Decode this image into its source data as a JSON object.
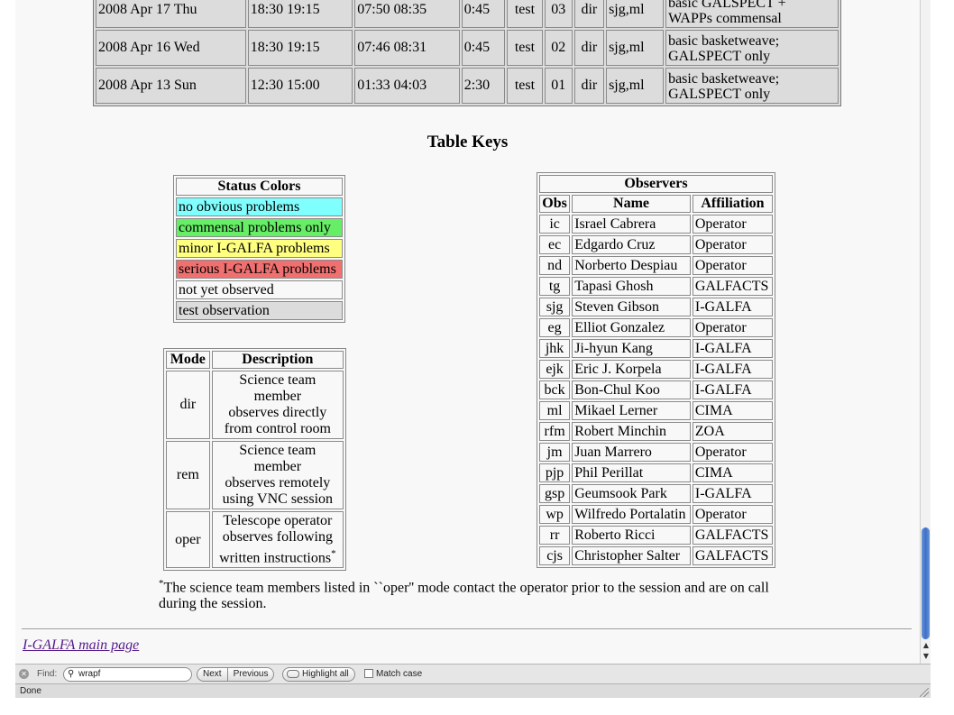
{
  "schedule": {
    "rows": [
      {
        "date": "2008 Apr 17 Thu",
        "lst": "18:30 19:15",
        "ast": "07:50 08:35",
        "dur": "0:45",
        "project": "test",
        "session": "03",
        "mode": "dir",
        "observers": "sjg,ml",
        "notes": "basic GALSPECT + WAPPs commensal",
        "notes_l1": "basic GALSPECT +",
        "notes_l2": "WAPPs commensal"
      },
      {
        "date": "2008 Apr 16 Wed",
        "lst": "18:30 19:15",
        "ast": "07:46 08:31",
        "dur": "0:45",
        "project": "test",
        "session": "02",
        "mode": "dir",
        "observers": "sjg,ml",
        "notes_l1": "basic basketweave;",
        "notes_l2": "GALSPECT only"
      },
      {
        "date": "2008 Apr 13 Sun",
        "lst": "12:30 15:00",
        "ast": "01:33 04:03",
        "dur": "2:30",
        "project": "test",
        "session": "01",
        "mode": "dir",
        "observers": "sjg,ml",
        "notes_l1": "basic basketweave;",
        "notes_l2": "GALSPECT only"
      }
    ]
  },
  "keys_title": "Table Keys",
  "status_colors": {
    "header": "Status Colors",
    "items": [
      {
        "label": "no obvious problems",
        "color": "#80ffff"
      },
      {
        "label": "commensal problems only",
        "color": "#66ee66"
      },
      {
        "label": "minor I-GALFA problems",
        "color": "#ffff80"
      },
      {
        "label": "serious I-GALFA problems",
        "color": "#f07070"
      },
      {
        "label": "not yet observed",
        "color": "#f8f8f8"
      },
      {
        "label": "test observation",
        "color": "#dcdcdc"
      }
    ]
  },
  "modes": {
    "header_mode": "Mode",
    "header_desc": "Description",
    "rows": [
      {
        "mode": "dir",
        "d1": "Science team",
        "d2": "member",
        "d3": "observes directly",
        "d4": "from control room"
      },
      {
        "mode": "rem",
        "d1": "Science team",
        "d2": "member",
        "d3": "observes remotely",
        "d4": "using VNC session"
      },
      {
        "mode": "oper",
        "d1": "Telescope operator",
        "d2": "observes following",
        "d3": "written instructions",
        "d4": "*"
      }
    ]
  },
  "observers": {
    "title": "Observers",
    "col_obs": "Obs",
    "col_name": "Name",
    "col_aff": "Affiliation",
    "rows": [
      {
        "obs": "ic",
        "name": "Israel Cabrera",
        "aff": "Operator"
      },
      {
        "obs": "ec",
        "name": "Edgardo Cruz",
        "aff": "Operator"
      },
      {
        "obs": "nd",
        "name": "Norberto Despiau",
        "aff": "Operator"
      },
      {
        "obs": "tg",
        "name": "Tapasi Ghosh",
        "aff": "GALFACTS"
      },
      {
        "obs": "sjg",
        "name": "Steven Gibson",
        "aff": "I-GALFA"
      },
      {
        "obs": "eg",
        "name": "Elliot Gonzalez",
        "aff": "Operator"
      },
      {
        "obs": "jhk",
        "name": "Ji-hyun Kang",
        "aff": "I-GALFA"
      },
      {
        "obs": "ejk",
        "name": "Eric J. Korpela",
        "aff": "I-GALFA"
      },
      {
        "obs": "bck",
        "name": "Bon-Chul Koo",
        "aff": "I-GALFA"
      },
      {
        "obs": "ml",
        "name": "Mikael Lerner",
        "aff": "CIMA"
      },
      {
        "obs": "rfm",
        "name": "Robert Minchin",
        "aff": "ZOA"
      },
      {
        "obs": "jm",
        "name": "Juan Marrero",
        "aff": "Operator"
      },
      {
        "obs": "pjp",
        "name": "Phil Perillat",
        "aff": "CIMA"
      },
      {
        "obs": "gsp",
        "name": "Geumsook Park",
        "aff": "I-GALFA"
      },
      {
        "obs": "wp",
        "name": "Wilfredo Portalatin",
        "aff": "Operator"
      },
      {
        "obs": "rr",
        "name": "Roberto Ricci",
        "aff": "GALFACTS"
      },
      {
        "obs": "cjs",
        "name": "Christopher Salter",
        "aff": "GALFACTS"
      }
    ]
  },
  "footnote": {
    "mark": "*",
    "text": "The science team members listed in ``oper'' mode contact the operator prior to the session and are on call during the session."
  },
  "main_link": "I-GALFA main page",
  "findbar": {
    "label": "Find:",
    "query": "wrapf",
    "next": "Next",
    "previous": "Previous",
    "highlight": "Highlight all",
    "match_case": "Match case"
  },
  "status_text": "Done"
}
